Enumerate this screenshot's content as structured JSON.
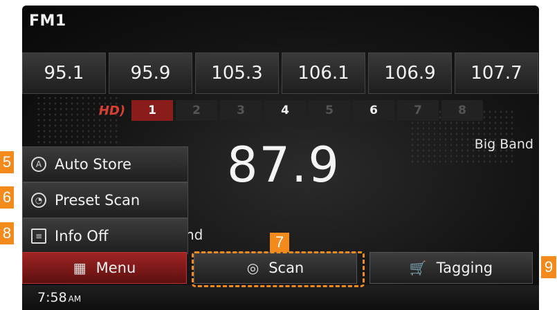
{
  "header": {
    "band": "FM1"
  },
  "presets": [
    "95.1",
    "95.9",
    "105.3",
    "106.1",
    "106.9",
    "107.7"
  ],
  "pages": {
    "hd_label": "HD)",
    "items": [
      {
        "label": "1",
        "state": "active"
      },
      {
        "label": "2",
        "state": "off"
      },
      {
        "label": "3",
        "state": "off"
      },
      {
        "label": "4",
        "state": "on"
      },
      {
        "label": "5",
        "state": "off"
      },
      {
        "label": "6",
        "state": "on"
      },
      {
        "label": "7",
        "state": "off"
      },
      {
        "label": "8",
        "state": "off"
      }
    ]
  },
  "station": {
    "frequency": "87.9",
    "genre": "Big Band",
    "partial_text": "nd"
  },
  "side_menu": {
    "auto_store": "Auto Store",
    "preset_scan": "Preset Scan",
    "info_off": "Info Off"
  },
  "bottom_bar": {
    "menu": "Menu",
    "scan": "Scan",
    "tagging": "Tagging"
  },
  "status": {
    "time": "7:58",
    "ampm": "AM"
  },
  "callouts": {
    "c5": "5",
    "c6": "6",
    "c7": "7",
    "c8": "8",
    "c9": "9"
  },
  "colors": {
    "accent_red": "#8a1c1c",
    "callout_orange": "#f28a1c"
  }
}
